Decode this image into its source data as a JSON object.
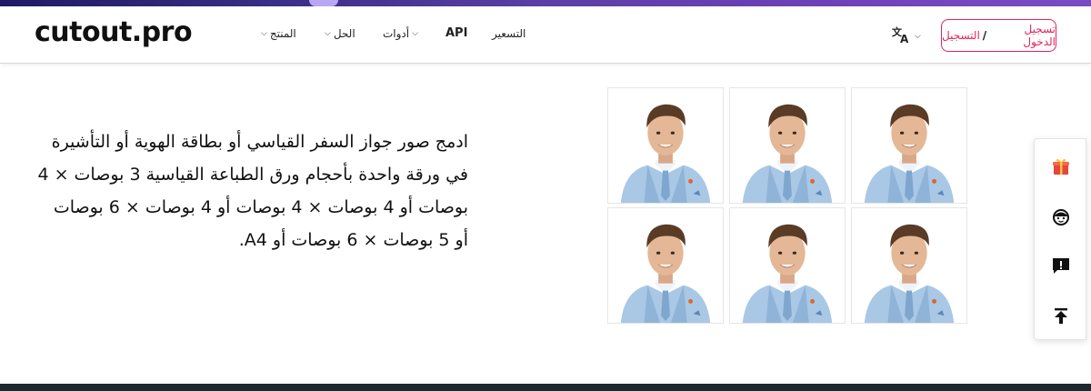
{
  "header": {
    "logo": "cutout.pro",
    "nav": [
      {
        "label": "المنتج"
      },
      {
        "label": "الحل"
      },
      {
        "label": "أدوات"
      },
      {
        "label": "API"
      },
      {
        "label": "التسعير"
      }
    ],
    "language_icon": "translate-icon",
    "login": {
      "login_label": "تسجيل الدخول",
      "separator": "/",
      "signup_label": "التسجيل"
    }
  },
  "main": {
    "description": "ادمج صور جواز السفر القياسي أو بطاقة الهوية أو التأشيرة في ورقة واحدة بأحجام ورق الطباعة القياسية 3 بوصات × 4 بوصات أو 4 بوصات × 4 بوصات أو 4 بوصات × 6 بوصات أو 5 بوصات × 6 بوصات أو A4."
  },
  "photos": {
    "count": 6,
    "subject": "passport-photo-man-blue-suit"
  },
  "sidebar": {
    "items": [
      {
        "icon": "gift-icon"
      },
      {
        "icon": "support-agent-icon"
      },
      {
        "icon": "feedback-icon"
      },
      {
        "icon": "back-to-top-icon"
      }
    ]
  },
  "colors": {
    "accent": "#e0245e",
    "topbar_start": "#1f1a63",
    "topbar_end": "#7a4cc4",
    "footer": "#1c2a30",
    "gift": "#e8453c"
  }
}
